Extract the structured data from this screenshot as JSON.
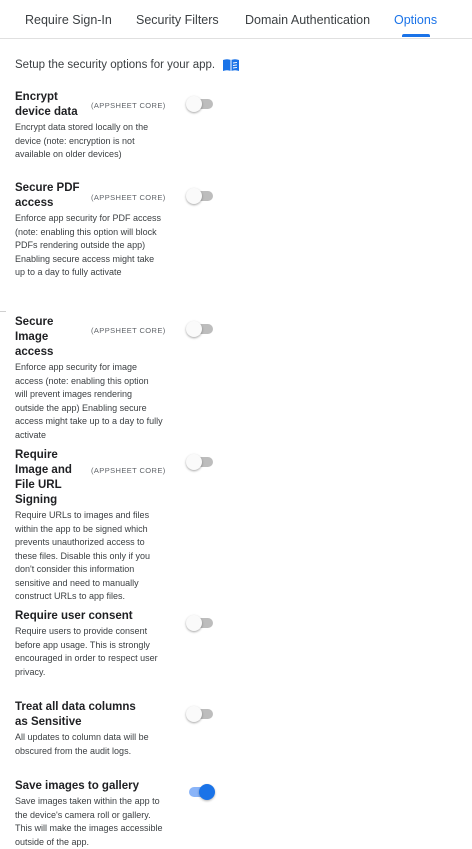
{
  "tabs": [
    {
      "label": "Require Sign-In",
      "active": false
    },
    {
      "label": "Security Filters",
      "active": false
    },
    {
      "label": "Domain Authentication",
      "active": false
    },
    {
      "label": "Options",
      "active": true
    }
  ],
  "intro": {
    "text": "Setup the security options for your app.",
    "icon": "book-icon"
  },
  "settings": [
    {
      "title": "Encrypt device data",
      "badge": "(APPSHEET CORE)",
      "description": "Encrypt data stored locally on the device (note: encryption is not available on older devices)",
      "enabled": false
    },
    {
      "title": "Secure PDF access",
      "badge": "(APPSHEET CORE)",
      "description": "Enforce app security for PDF access (note: enabling this option will block PDFs rendering outside the app) Enabling secure access might take up to a day to fully activate",
      "enabled": false
    },
    {
      "title": "Secure Image access",
      "badge": "(APPSHEET CORE)",
      "description": "Enforce app security for image access (note: enabling this option will prevent images rendering outside the app) Enabling secure access might take up to a day to fully activate",
      "enabled": false
    },
    {
      "title": "Require Image and File URL Signing",
      "badge": "(APPSHEET CORE)",
      "description": "Require URLs to images and files within the app to be signed which prevents unauthorized access to these files. Disable this only if you don't consider this information sensitive and need to manually construct URLs to app files.",
      "enabled": false
    },
    {
      "title": "Require user consent",
      "badge": "",
      "description": "Require users to provide consent before app usage. This is strongly encouraged in order to respect user privacy.",
      "enabled": false
    },
    {
      "title": "Treat all data columns as Sensitive",
      "badge": "",
      "description": "All updates to column data will be obscured from the audit logs.",
      "enabled": false
    },
    {
      "title": "Save images to gallery",
      "badge": "",
      "description": "Save images taken within the app to the device's camera roll or gallery. This will make the images accessible outside of the app.",
      "enabled": true
    }
  ],
  "colors": {
    "accent": "#1a73e8",
    "toggle_off": "#bdbdbd",
    "toggle_on_track": "#8ab4f8"
  }
}
